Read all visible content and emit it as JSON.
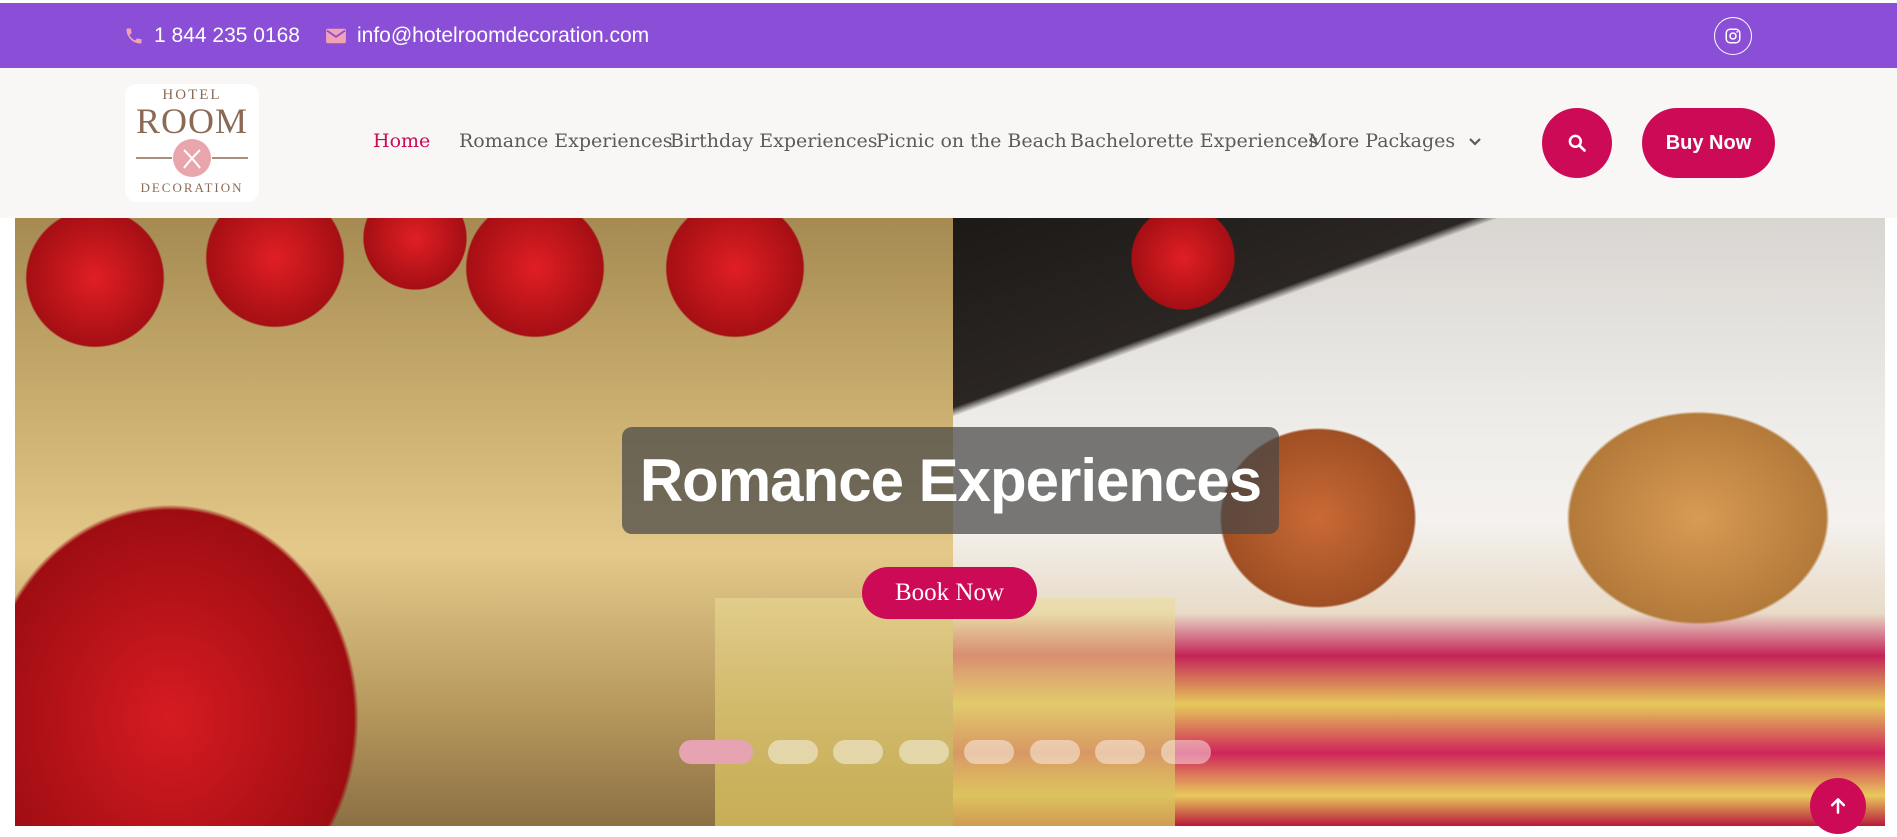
{
  "topbar": {
    "phone": "1 844 235 0168",
    "email": "info@hotelroomdecoration.com",
    "bg_color": "#8a4fd6",
    "icons": [
      "phone-icon",
      "mail-icon",
      "instagram-icon"
    ]
  },
  "logo": {
    "line1": "HOTEL",
    "line2": "ROOM",
    "line3": "DECORATION"
  },
  "nav": {
    "items": [
      {
        "label": "Home",
        "active": true
      },
      {
        "label": "Romance Experiences"
      },
      {
        "label": "Birthday Experiences"
      },
      {
        "label": "Picnic on the Beach"
      },
      {
        "label": "Bachelorette Experiences"
      },
      {
        "label": "More Packages"
      }
    ]
  },
  "actions": {
    "buy_label": "Buy Now",
    "accent_color": "#cc0a55"
  },
  "hero": {
    "title": "Romance Experiences",
    "cta_label": "Book Now",
    "slides": {
      "count": 8,
      "active": 0
    }
  }
}
